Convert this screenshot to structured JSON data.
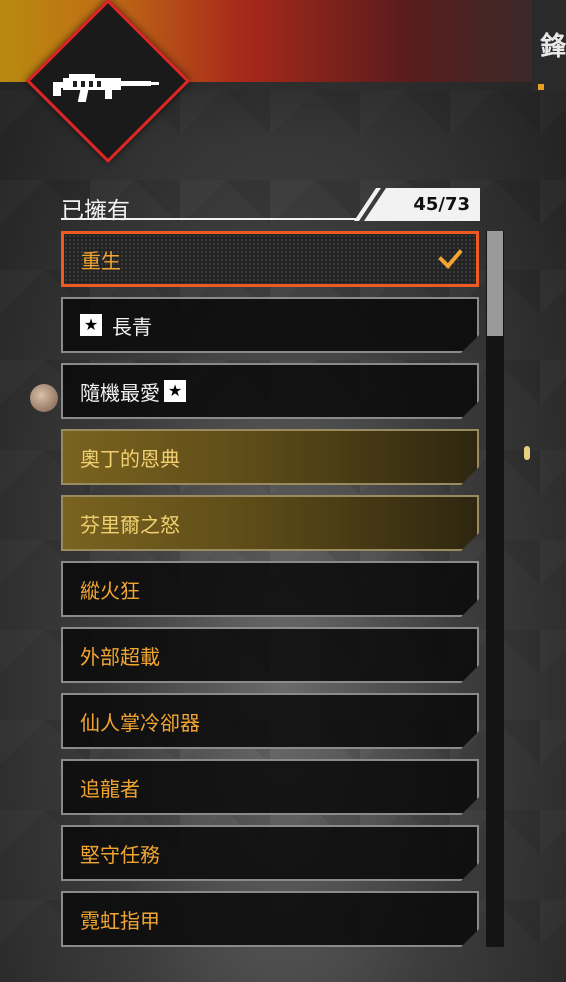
{
  "header": {
    "right_char": "鋒",
    "owned_label": "已擁有",
    "owned_count": "45/73"
  },
  "emblem": {
    "icon": "rifle-icon"
  },
  "items": [
    {
      "label": "重生",
      "state": "selected",
      "prefix_icon": null,
      "suffix_icon": null,
      "checked": true
    },
    {
      "label": "長青",
      "state": "normal",
      "prefix_icon": "star-badge-icon",
      "suffix_icon": null,
      "checked": false
    },
    {
      "label": "隨機最愛",
      "state": "normal",
      "prefix_icon": null,
      "suffix_icon": "star-badge-icon",
      "checked": false
    },
    {
      "label": "奧丁的恩典",
      "state": "gold",
      "checked": false
    },
    {
      "label": "芬里爾之怒",
      "state": "gold",
      "checked": false
    },
    {
      "label": "縱火狂",
      "state": "orange",
      "checked": false
    },
    {
      "label": "外部超載",
      "state": "orange",
      "checked": false
    },
    {
      "label": "仙人掌冷卻器",
      "state": "orange",
      "checked": false
    },
    {
      "label": "追龍者",
      "state": "orange",
      "checked": false
    },
    {
      "label": "堅守任務",
      "state": "orange",
      "checked": false
    },
    {
      "label": "霓虹指甲",
      "state": "orange",
      "checked": false
    }
  ],
  "scroll": {
    "visible_fraction": 0.15
  },
  "colors": {
    "accent_orange": "#ee5a24",
    "gold_text": "#f0d070",
    "rare_text": "#f2a530",
    "emblem_border": "#e02525"
  }
}
